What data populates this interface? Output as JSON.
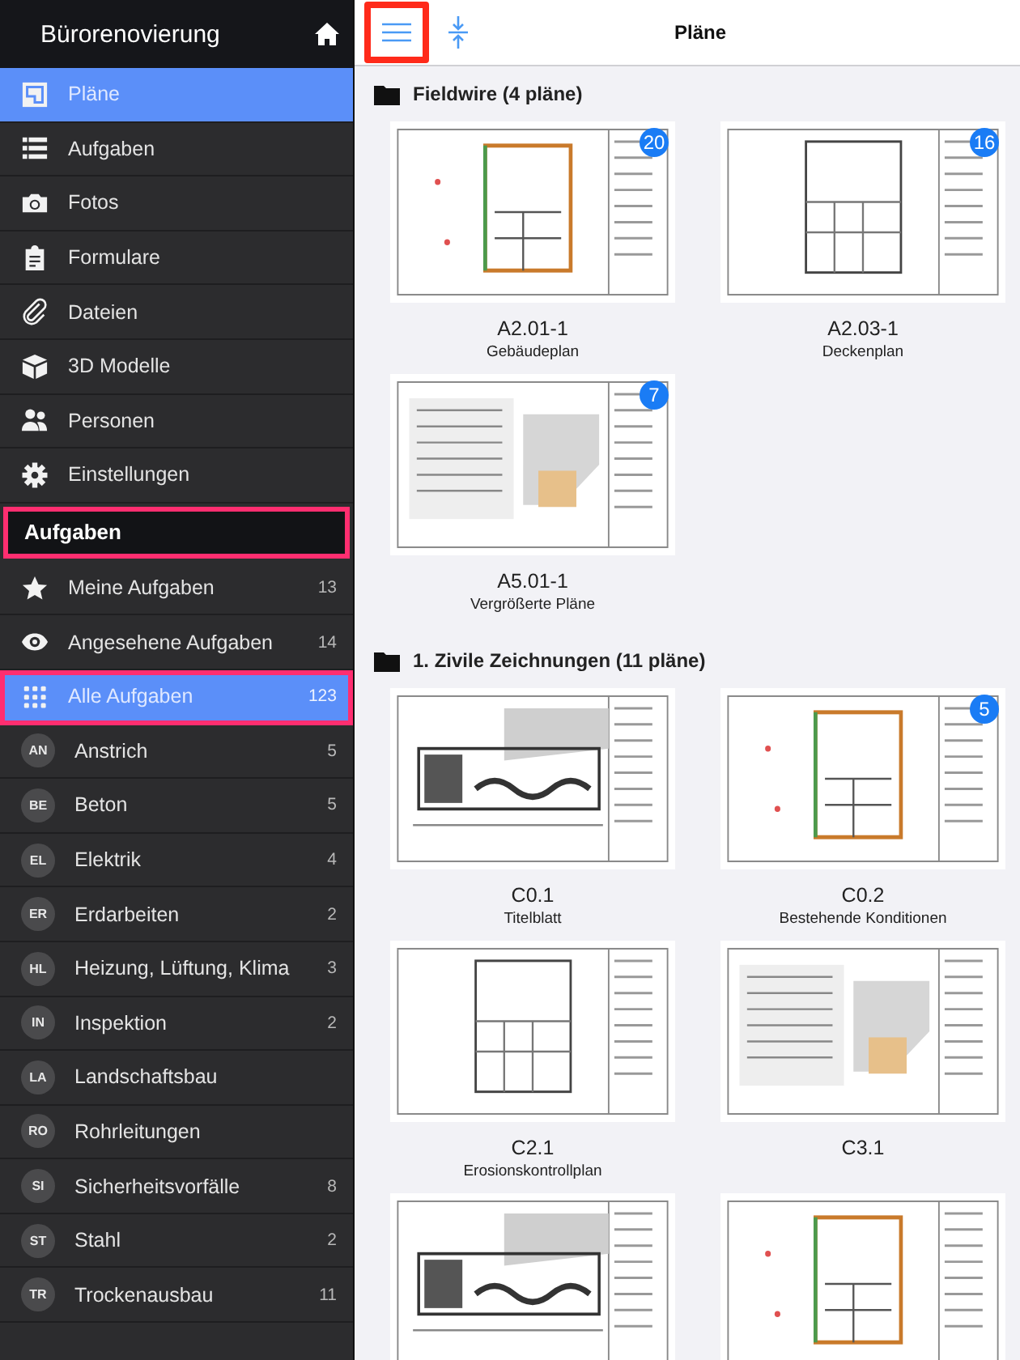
{
  "sidebar": {
    "project_title": "Bürorenovierung",
    "nav_items": [
      {
        "label": "Pläne",
        "selected": true
      },
      {
        "label": "Aufgaben",
        "selected": false
      },
      {
        "label": "Fotos",
        "selected": false
      },
      {
        "label": "Formulare",
        "selected": false
      },
      {
        "label": "Dateien",
        "selected": false
      },
      {
        "label": "3D Modelle",
        "selected": false
      },
      {
        "label": "Personen",
        "selected": false
      },
      {
        "label": "Einstellungen",
        "selected": false
      }
    ],
    "section_header": {
      "label": "Aufgaben",
      "highlighted": true
    },
    "task_filters": [
      {
        "label": "Meine Aufgaben",
        "count": "13",
        "selected": false,
        "highlighted": false
      },
      {
        "label": "Angesehene Aufgaben",
        "count": "14",
        "selected": false,
        "highlighted": false
      },
      {
        "label": "Alle Aufgaben",
        "count": "123",
        "selected": true,
        "highlighted": true
      }
    ],
    "categories": [
      {
        "initials": "AN",
        "label": "Anstrich",
        "count": "5"
      },
      {
        "initials": "BE",
        "label": "Beton",
        "count": "5"
      },
      {
        "initials": "EL",
        "label": "Elektrik",
        "count": "4"
      },
      {
        "initials": "ER",
        "label": "Erdarbeiten",
        "count": "2"
      },
      {
        "initials": "HL",
        "label": "Heizung, Lüftung, Klima",
        "count": "3"
      },
      {
        "initials": "IN",
        "label": "Inspektion",
        "count": "2"
      },
      {
        "initials": "LA",
        "label": "Landschaftsbau"
      },
      {
        "initials": "RO",
        "label": "Rohrleitungen"
      },
      {
        "initials": "SI",
        "label": "Sicherheitsvorfälle",
        "count": "8"
      },
      {
        "initials": "ST",
        "label": "Stahl",
        "count": "2"
      },
      {
        "initials": "TR",
        "label": "Trockenausbau",
        "count": "11"
      }
    ]
  },
  "toolbar": {
    "title": "Pläne",
    "menu_button_highlighted": true
  },
  "folders": [
    {
      "name": "Fieldwire (4 pläne)",
      "plans": [
        {
          "kind": "sheet",
          "code": "A2.01-1",
          "name": "Gebäudeplan",
          "badge": "20"
        },
        {
          "kind": "sheet",
          "code": "A2.03-1",
          "name": "Deckenplan",
          "badge": "16"
        },
        {
          "kind": "sheet",
          "code": "A5.01-1",
          "name": "Vergrößerte Pläne",
          "badge": "7"
        }
      ]
    },
    {
      "name": "1. Zivile Zeichnungen (11 pläne)",
      "plans": [
        {
          "kind": "sheet",
          "code": "C0.1",
          "name": "Titelblatt"
        },
        {
          "kind": "sheet",
          "code": "C0.2",
          "name": "Bestehende Konditionen",
          "badge": "5"
        },
        {
          "kind": "sheet",
          "code": "C2.1",
          "name": "Erosionskontrollplan"
        },
        {
          "kind": "sheet",
          "code": "C3.1"
        },
        {
          "kind": "picture"
        },
        {
          "kind": "picture"
        }
      ]
    }
  ]
}
